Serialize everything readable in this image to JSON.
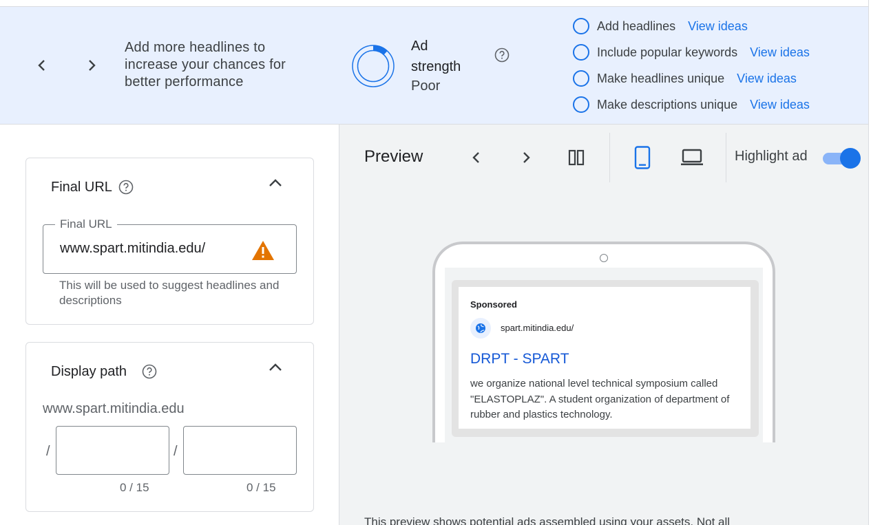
{
  "banner": {
    "message": "Add more headlines to increase your chances for better performance",
    "ad_strength_label_line1": "Ad",
    "ad_strength_label_line2": "strength",
    "ad_strength_value": "Poor",
    "ad_strength_fraction": 0.12,
    "tips": [
      {
        "label": "Add headlines",
        "link": "View ideas"
      },
      {
        "label": "Include popular keywords",
        "link": "View ideas"
      },
      {
        "label": "Make headlines unique",
        "link": "View ideas"
      },
      {
        "label": "Make descriptions unique",
        "link": "View ideas"
      }
    ]
  },
  "final_url_card": {
    "title": "Final URL",
    "field_label": "Final URL",
    "field_value": "www.spart.mitindia.edu/",
    "hint": "This will be used to suggest headlines and descriptions"
  },
  "display_path_card": {
    "title": "Display path",
    "base": "www.spart.mitindia.edu",
    "separator": "/",
    "path1_counter": "0 / 15",
    "path2_counter": "0 / 15"
  },
  "preview": {
    "title": "Preview",
    "highlight_label": "Highlight ad",
    "highlight_on": true,
    "device_selected": "mobile",
    "ad": {
      "sponsored": "Sponsored",
      "url": "spart.mitindia.edu/",
      "headline": "DRPT - SPART",
      "description": "we organize national level technical symposium called \"ELASTOPLAZ\". A student organization of department of rubber and plastics technology."
    },
    "disclaimer": "This preview shows potential ads assembled using your assets. Not all"
  },
  "colors": {
    "accent": "#1a73e8",
    "banner_bg": "#e8f0fe",
    "warning": "#e37400",
    "preview_bg": "#f1f3f4"
  }
}
